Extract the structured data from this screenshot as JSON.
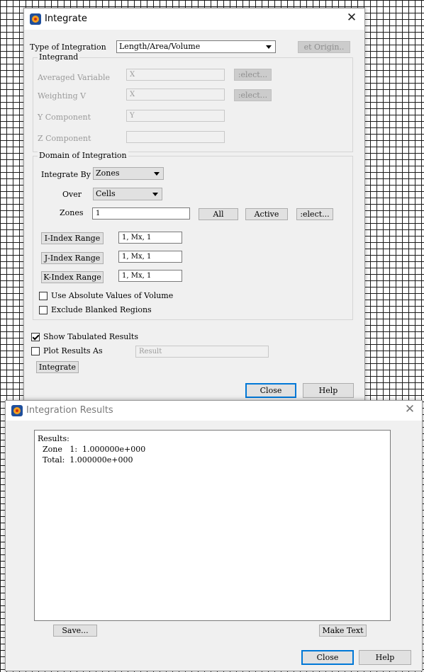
{
  "integrate_window": {
    "title": "Integrate",
    "type_label": "Type of Integration",
    "type_value": "Length/Area/Volume",
    "set_origin_label": "et Origin..",
    "integrand": {
      "legend": "Integrand",
      "averaged_variable_label": "Averaged Variable",
      "averaged_variable_value": "X",
      "weighting_label": "Weighting V",
      "weighting_value": "X",
      "select_label": ":elect...",
      "y_component_label": "Y Component",
      "y_component_value": "Y",
      "z_component_label": "Z Component",
      "z_component_value": ""
    },
    "domain": {
      "legend": "Domain of Integration",
      "integrate_by_label": "Integrate By",
      "integrate_by_value": "Zones",
      "over_label": "Over",
      "over_value": "Cells",
      "zones_label": "Zones",
      "zones_value": "1",
      "all_label": "All",
      "active_label": "Active",
      "select_label": ":elect...",
      "i_index_label": "I-Index Range",
      "i_index_value": "1, Mx, 1",
      "j_index_label": "J-Index Range",
      "j_index_value": "1, Mx, 1",
      "k_index_label": "K-Index Range",
      "k_index_value": "1, Mx, 1",
      "absolute_label": "Use Absolute Values of Volume",
      "absolute_checked": false,
      "exclude_label": "Exclude Blanked Regions",
      "exclude_checked": false
    },
    "show_tabulated_label": "Show Tabulated Results",
    "show_tabulated_checked": true,
    "plot_results_label": "Plot Results As",
    "plot_results_checked": false,
    "plot_results_value": "Result",
    "integrate_button": "Integrate",
    "close_button": "Close",
    "help_button": "Help"
  },
  "results_window": {
    "title": "Integration Results",
    "results_text": "Results:\n  Zone   1:  1.000000e+000\n  Total:  1.000000e+000",
    "save_button": "Save...",
    "make_text_button": "Make Text",
    "close_button": "Close",
    "help_button": "Help"
  },
  "colors": {
    "accent": "#0078d7",
    "disabled_text": "#9a9a9a"
  }
}
